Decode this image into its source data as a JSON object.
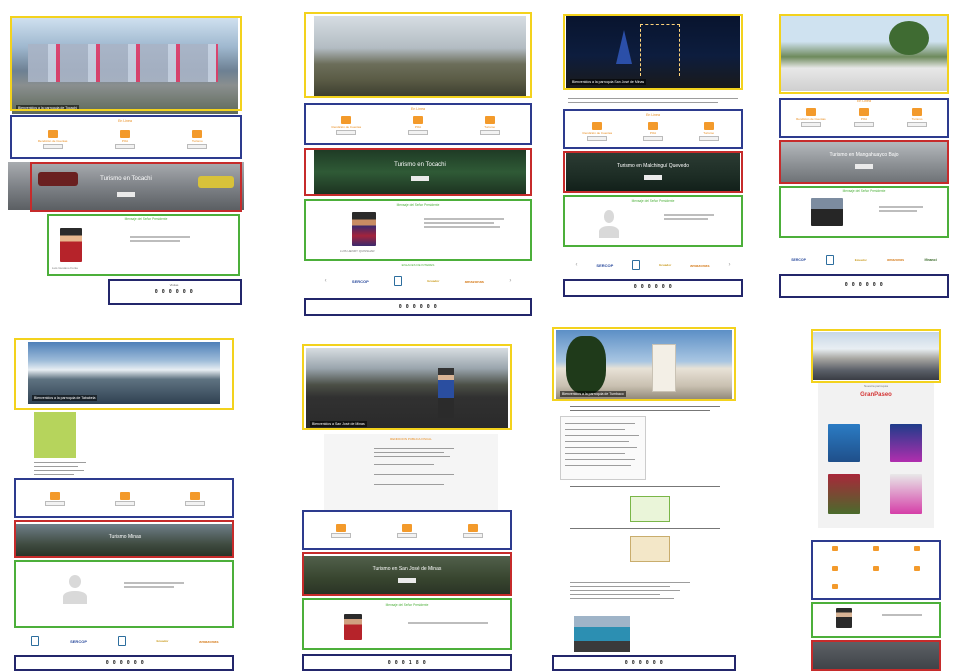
{
  "pages": [
    {
      "hero_caption": "Bienvenidos a la parroquia de Tocachi",
      "services": {
        "title": "En Linea",
        "items": [
          {
            "label": "Rendición de Cuentas",
            "icon": "chart-icon"
          },
          {
            "label": "POA",
            "icon": "document-icon"
          },
          {
            "label": "Turismo",
            "icon": "camera-icon"
          }
        ]
      },
      "banner": "Turismo en Tocachi",
      "greeting_title": "Mensaje del Señor Presidente",
      "president_name": "Luis Gustavo Fonte",
      "footer_title": "Visitas"
    },
    {
      "hero_caption": "",
      "services": {
        "title": "En Línea",
        "items": [
          {
            "label": "Rendición de Cuentas",
            "icon": "chart-icon"
          },
          {
            "label": "POA",
            "icon": "document-icon"
          },
          {
            "label": "Turismo",
            "icon": "camera-icon"
          }
        ]
      },
      "banner": "Turismo en Tocachi",
      "greeting_title": "Mensaje del Señor Presidente",
      "president_name": "LUIS HENRY QUINSHAR",
      "links_title": "ENLACES DE INTERES",
      "links": [
        "SERCOP",
        "Ecuador",
        "Consejo",
        "amazonas"
      ]
    },
    {
      "hero_caption": "Bienvenidos a la parroquia San José de Minas",
      "services": {
        "title": "En Linea",
        "items": [
          {
            "label": "Rendición de Cuentas",
            "icon": "chart-icon"
          },
          {
            "label": "POA",
            "icon": "document-icon"
          },
          {
            "label": "Turismo",
            "icon": "camera-icon"
          }
        ]
      },
      "banner": "Turismo en Malchinguí Quevedo",
      "greeting_title": "Mensaje del Señor Presidente",
      "links": [
        "SERCOP",
        "Ecuador",
        "Consejo",
        "amazonas"
      ]
    },
    {
      "services": {
        "title": "En Linea",
        "items": [
          {
            "label": "Rendición de Cuentas",
            "icon": "chart-icon"
          },
          {
            "label": "POA",
            "icon": "document-icon"
          },
          {
            "label": "Turismo",
            "icon": "camera-icon"
          }
        ]
      },
      "banner": "Turismo en Mangahuayco Bajo",
      "greeting_title": "Mensaje del Señor Presidente",
      "links": [
        "SERCOP",
        "Ecuador",
        "Consejo",
        "amazonas",
        "Ifinanci"
      ]
    },
    {
      "hero_caption": "Bienvenidos a la parroquia de Tababela",
      "banner": "Turismo Minas"
    },
    {
      "hero_caption": "Bienvenidos a San José de Minas",
      "notice_title": "RENDICION PUBLICA FISCAL",
      "banner": "Turismo en San José de Minas",
      "greeting_title": "Mensaje del Señor Presidente"
    },
    {
      "hero_caption": "Bienvenidos a la parroquia de Tumbaco"
    },
    {
      "events_title": "Nuestra parroquia",
      "event_logo": "GranPaseo"
    }
  ],
  "footer": {
    "counter": "0 0 0 0 0 0",
    "counter_alt": "0 0 0 1 8 0"
  },
  "colors": {
    "section_a": "#f3d21d",
    "section_b": "#2d3b8e",
    "section_c": "#c62b2b",
    "section_d": "#4caf3a",
    "section_e": "#23266b",
    "accent": "#f39a2b"
  }
}
